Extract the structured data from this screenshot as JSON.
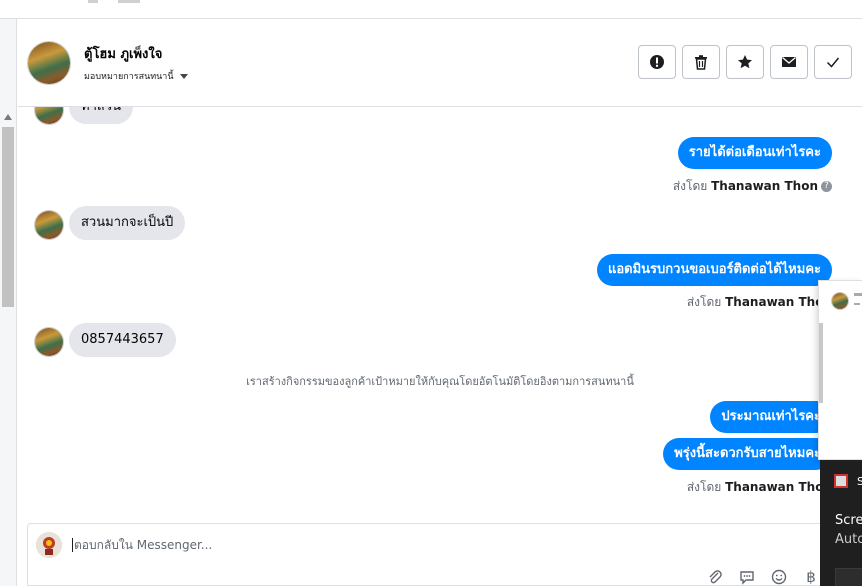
{
  "header": {
    "contact_name": "ตู้โฮม ภูเพ็งใจ",
    "assign_label": "มอบหมายการสนทนานี้",
    "actions": [
      {
        "name": "mark-spam-button",
        "icon": "exclamation-icon"
      },
      {
        "name": "delete-button",
        "icon": "trash-icon"
      },
      {
        "name": "star-button",
        "icon": "star-icon"
      },
      {
        "name": "mark-unread-button",
        "icon": "envelope-icon"
      },
      {
        "name": "mark-done-button",
        "icon": "check-icon"
      }
    ]
  },
  "messages": {
    "m0_partial": "ทำสวน",
    "m1": "รายได้ต่อเดือนเท่าไรคะ",
    "m1_sentby_prefix": "ส่งโดย",
    "m1_sentby_name": "Thanawan Thon",
    "m2": "สวนมากจะเป็นปี",
    "m3": "แอดมินรบกวนขอเบอร์ติดต่อได้ไหมคะ",
    "m3_sentby_prefix": "ส่งโดย",
    "m3_sentby_name": "Thanawan Thon",
    "m4": "0857443657",
    "system_note": "เราสร้างกิจกรรมของลูกค้าเป้าหมายให้กับคุณโดยอัตโนมัติโดยอิงตามการสนทนานี้",
    "m5": "ประมาณเท่าไรคะ",
    "m6": "พรุ่งนี้สะดวกรับสายไหมคะ",
    "m6_sentby_prefix": "ส่งโดย",
    "m6_sentby_name": "Thanawan Thon"
  },
  "composer": {
    "placeholder": "ตอบกลับใน Messenger..."
  },
  "toast": {
    "title_initial": "S",
    "line1": "Scre",
    "line2": "Auto"
  },
  "colors": {
    "outgoing_bubble": "#0084ff",
    "incoming_bubble": "#e4e6eb",
    "border": "#dddfe2"
  }
}
